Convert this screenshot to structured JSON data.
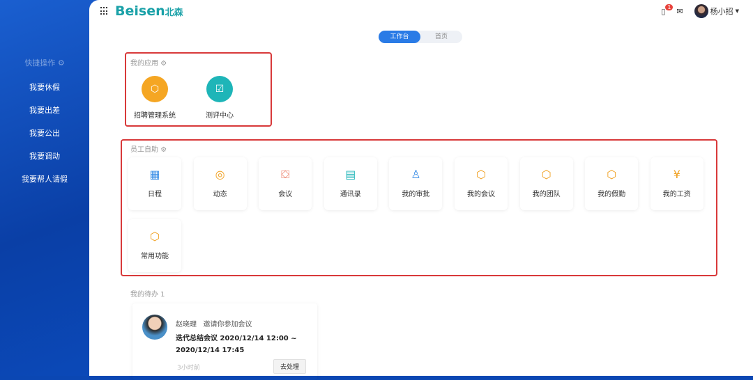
{
  "sidebar": {
    "title": "快捷操作",
    "items": [
      "我要休假",
      "我要出差",
      "我要公出",
      "我要调动",
      "我要帮人请假"
    ]
  },
  "header": {
    "logo": "Beisen",
    "logo_cn": "北森",
    "notif_count": "1",
    "user": "杨小招"
  },
  "tabs": [
    {
      "label": "工作台",
      "active": true
    },
    {
      "label": "首页",
      "active": false
    }
  ],
  "my_apps": {
    "title": "我的应用",
    "items": [
      {
        "label": "招聘管理系统",
        "color": "#f5a623"
      },
      {
        "label": "测评中心",
        "color": "#1eb5b8"
      }
    ]
  },
  "self_service": {
    "title": "员工自助",
    "items": [
      {
        "label": "日程",
        "icon": "calendar-icon",
        "glyph": "▦",
        "color": "#3a8ee6"
      },
      {
        "label": "动态",
        "icon": "activity-icon",
        "glyph": "◎",
        "color": "#f0a020"
      },
      {
        "label": "会议",
        "icon": "meeting-icon",
        "glyph": "⛋",
        "color": "#e8654a"
      },
      {
        "label": "通讯录",
        "icon": "contacts-icon",
        "glyph": "▤",
        "color": "#1eb5b8"
      },
      {
        "label": "我的审批",
        "icon": "approval-icon",
        "glyph": "♙",
        "color": "#3a8ee6"
      },
      {
        "label": "我的会议",
        "icon": "cube-icon",
        "glyph": "⬡",
        "color": "#f0a020"
      },
      {
        "label": "我的团队",
        "icon": "cube-icon",
        "glyph": "⬡",
        "color": "#f0a020"
      },
      {
        "label": "我的假勤",
        "icon": "cube-icon",
        "glyph": "⬡",
        "color": "#f0a020"
      },
      {
        "label": "我的工资",
        "icon": "salary-icon",
        "glyph": "¥",
        "color": "#f0a020"
      },
      {
        "label": "常用功能",
        "icon": "cube-icon",
        "glyph": "⬡",
        "color": "#f0a020"
      }
    ]
  },
  "todo": {
    "title": "我的待办 1",
    "sender": "赵晓理",
    "action": "邀请你参加会议",
    "line1": "迭代总结会议 2020/12/14 12:00 ~",
    "line2": "2020/12/14 17:45",
    "time": "3小时前",
    "button": "去处理"
  }
}
